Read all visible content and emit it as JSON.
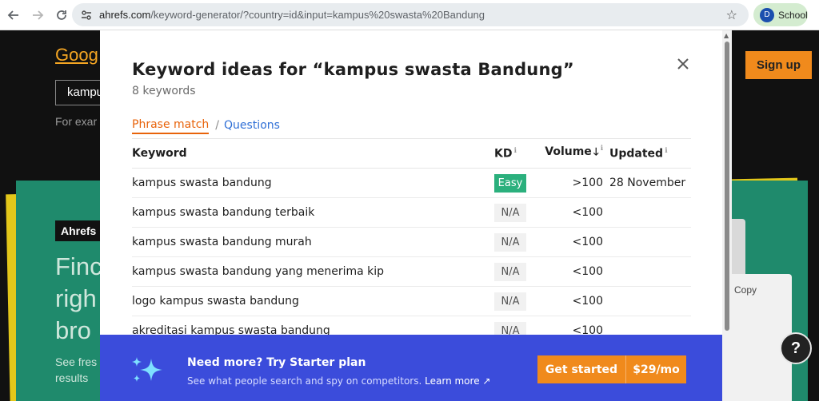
{
  "browser": {
    "url_host": "ahrefs.com",
    "url_rest": "/keyword-generator/?country=id&input=kampus%20swasta%20Bandung",
    "profile_initial": "D",
    "profile_name": "School",
    "icons": [
      "back-arrow-icon",
      "forward-arrow-icon",
      "reload-icon",
      "site-info-icon",
      "bookmark-star-icon"
    ]
  },
  "background": {
    "title": "Goog",
    "input_value": "kampu",
    "example": "For exar",
    "signup": "Sign up",
    "badge": "Ahrefs",
    "headline_lines": [
      "Finc",
      "righ",
      "bro"
    ],
    "small_lines": [
      "See fres",
      "results"
    ],
    "copy": "Copy",
    "help": "?"
  },
  "modal": {
    "title": "Keyword ideas for “kampus swasta Bandung”",
    "count": "8 keywords",
    "tabs": {
      "phrase_match": "Phrase match",
      "separator": "/",
      "questions": "Questions"
    },
    "columns": {
      "keyword": "Keyword",
      "kd": "KD",
      "volume": "Volume",
      "updated": "Updated"
    },
    "rows": [
      {
        "keyword": "kampus swasta bandung",
        "kd": "Easy",
        "volume": ">100",
        "updated": "28 November"
      },
      {
        "keyword": "kampus swasta bandung terbaik",
        "kd": "N/A",
        "volume": "<100",
        "updated": ""
      },
      {
        "keyword": "kampus swasta bandung murah",
        "kd": "N/A",
        "volume": "<100",
        "updated": ""
      },
      {
        "keyword": "kampus swasta bandung yang menerima kip",
        "kd": "N/A",
        "volume": "<100",
        "updated": ""
      },
      {
        "keyword": "logo kampus swasta bandung",
        "kd": "N/A",
        "volume": "<100",
        "updated": ""
      },
      {
        "keyword": "akreditasi kampus swasta bandung",
        "kd": "N/A",
        "volume": "<100",
        "updated": ""
      }
    ]
  },
  "promo": {
    "title": "Need more? Try Starter plan",
    "subtitle": "See what people search and spy on competitors.",
    "link": "Learn more ↗",
    "cta_label": "Get started",
    "cta_price": "$29/mo"
  },
  "colors": {
    "accent_orange": "#f08a1c",
    "tab_orange": "#e8630a",
    "link_blue": "#2f6fd6",
    "promo_blue": "#3b4cdb",
    "easy_green": "#2bb07d"
  }
}
